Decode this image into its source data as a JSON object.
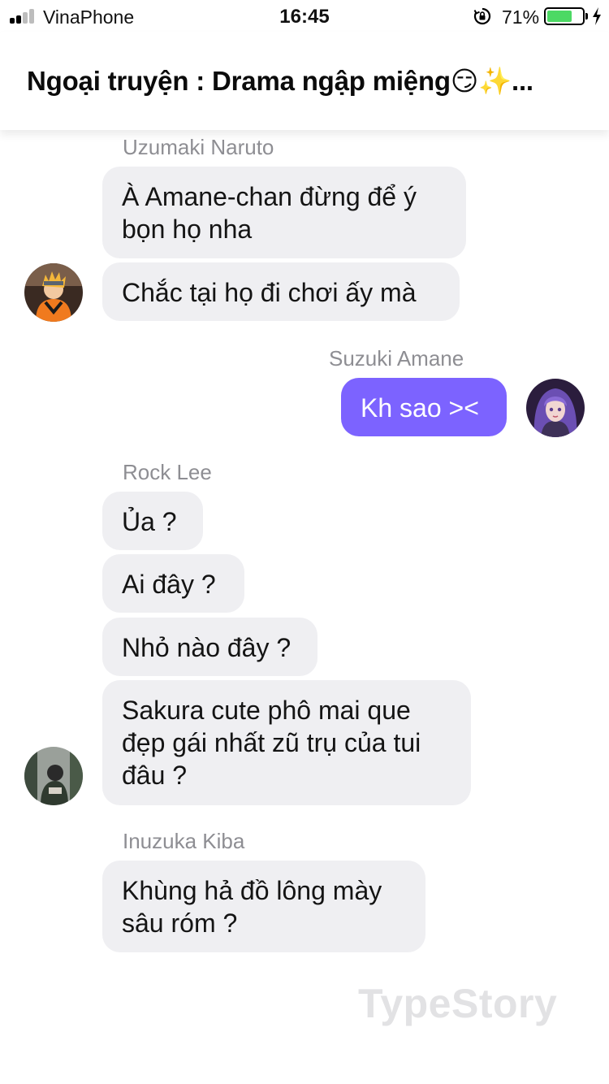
{
  "status_bar": {
    "carrier": "VinaPhone",
    "time": "16:45",
    "battery_percent": "71%",
    "battery_level": 0.71,
    "icons": [
      "signal-icon",
      "rotation-lock-icon",
      "battery-icon",
      "charging-icon"
    ]
  },
  "header": {
    "title": "Ngoại truyện : Drama ngập miệng😏✨..."
  },
  "messages": [
    {
      "sender": "Uzumaki Naruto",
      "side": "left",
      "bubbles": [
        "À Amane-chan đừng để ý bọn họ nha",
        "Chắc tại họ đi chơi ấy mà"
      ]
    },
    {
      "sender": "Suzuki Amane",
      "side": "right",
      "bubbles": [
        "Kh sao ><"
      ]
    },
    {
      "sender": "Rock Lee",
      "side": "left",
      "bubbles": [
        "Ủa ?",
        "Ai đây ?",
        "Nhỏ nào đây ?",
        "Sakura cute phô mai que đẹp gái nhất zũ trụ của tui đâu ?"
      ]
    },
    {
      "sender": "Inuzuka Kiba",
      "side": "left",
      "bubbles": [
        "Khùng hả đồ lông mày sâu róm ?"
      ]
    }
  ],
  "colors": {
    "my_bubble": "#7c63ff",
    "other_bubble": "#efeff2",
    "sender_name": "#8e8e93",
    "battery_fill": "#4cd964"
  },
  "watermark": "TypeStory"
}
